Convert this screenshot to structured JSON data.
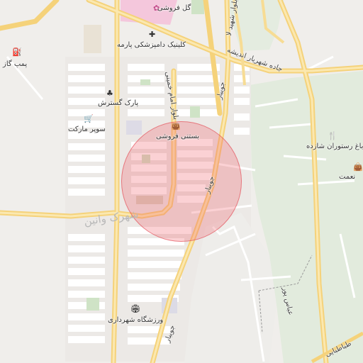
{
  "map": {
    "district_label": "شهرک وانین",
    "poi": {
      "flower_shop": "گل فروشی",
      "clinic": "کلینیک دامپزشکی پارمه",
      "gas_station": "پمپ گاز",
      "park": "پارک گسترش",
      "supermarket": "سوپر مارکت",
      "icecream_shop": "بستنی فروشی",
      "garden_restaurant": "باغ رستوران شازده",
      "nemat": "نعمت",
      "stadium": "ورزشگاه شهرداری"
    },
    "roads": {
      "jadeh": "جاده شهریار اندیشه",
      "imam_khomeini": "بلوار امام خمینی",
      "joybar_1": "جویبار",
      "joybar_2": "جویبار",
      "joybar_3": "جویبار",
      "shahid_bolvar": "بلوار شهید لا",
      "abbas_pour": "عباس پور",
      "tabatabai": "طباطبایی"
    },
    "icons": {
      "gas": "gas-station-icon",
      "clinic": "cross-icon",
      "park": "tree-icon",
      "cart": "cart-icon",
      "bag": "shopping-bag-icon",
      "restaurant": "fork-knife-icon",
      "stadium": "stadium-icon"
    },
    "colors": {
      "background": "#f0eeeb",
      "major_road": "#f5d37a",
      "green_area": "#e1ebdc",
      "circle_fill": "#f05a64",
      "pink_area": "#f4c8dc"
    }
  }
}
